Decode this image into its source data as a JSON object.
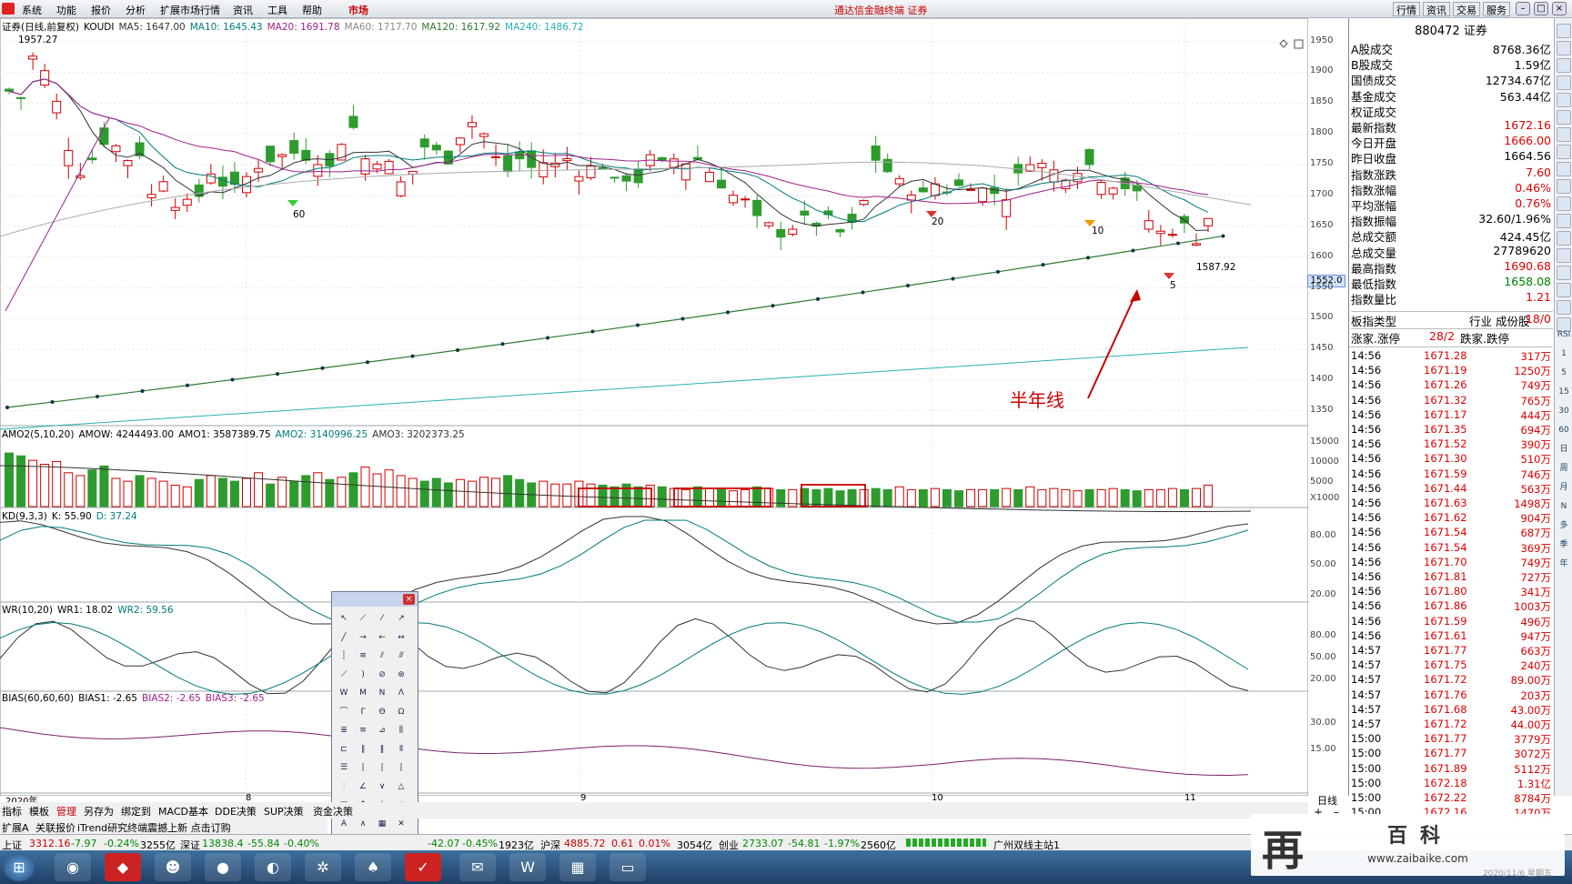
{
  "menubar": {
    "items": [
      "系统",
      "功能",
      "报价",
      "分析",
      "扩展市场行情",
      "资讯",
      "工具",
      "帮助"
    ],
    "market": "市场",
    "app_title": "通达信金融终端",
    "app_subtitle": "证券",
    "right_buttons": [
      "行情",
      "资讯",
      "交易",
      "服务"
    ]
  },
  "main_chart": {
    "header": {
      "name": "证券(日线,前复权)",
      "indicator": "KOUDI",
      "ma5": "MA5: 1647.00",
      "ma10": "MA10: 1645.43",
      "ma20": "MA20: 1691.78",
      "ma60": "MA60: 1717.70",
      "ma120": "MA120: 1617.92",
      "ma240": "MA240: 1486.72"
    },
    "y_ticks": [
      "1950",
      "1900",
      "1850",
      "1800",
      "1750",
      "1700",
      "1650",
      "1600",
      "1550",
      "1500",
      "1450",
      "1400",
      "1350"
    ],
    "price_box": "1552.0",
    "high_label": "1957.27",
    "low_label": "1587.92",
    "annotation": "半年线",
    "signal_labels": [
      "60",
      "20",
      "10",
      "5"
    ],
    "x_labels": [
      "2020年",
      "8",
      "9",
      "10",
      "11"
    ],
    "period": "日线"
  },
  "amo_panel": {
    "header": "AMO2(5,10,20)",
    "amow": "AMOW: 4244493.00",
    "amo1": "AMO1: 3587389.75",
    "amo2": "AMO2: 3140996.25",
    "amo3": "AMO3: 3202373.25",
    "y_ticks": [
      "15000",
      "10000",
      "5000",
      "X1000"
    ]
  },
  "kd_panel": {
    "header": "KD(9,3,3)",
    "k": "K: 55.90",
    "d": "D: 37.24",
    "y_ticks": [
      "80.00",
      "50.00",
      "20.00"
    ]
  },
  "wr_panel": {
    "header": "WR(10,20)",
    "wr1": "WR1: 18.02",
    "wr2": "WR2: 59.56",
    "y_ticks": [
      "80.00",
      "50.00",
      "20.00"
    ]
  },
  "bias_panel": {
    "header": "BIAS(60,60,60)",
    "bias1": "BIAS1: -2.65",
    "bias2": "BIAS2: -2.65",
    "bias3": "BIAS3: -2.65",
    "y_ticks": [
      "30.00",
      "15.00"
    ]
  },
  "right_panel": {
    "code": "880472",
    "name": "证券",
    "rows": [
      {
        "label": "A股成交",
        "value": "8768.36亿",
        "color": "blk"
      },
      {
        "label": "B股成交",
        "value": "1.59亿",
        "color": "blk"
      },
      {
        "label": "国债成交",
        "value": "12734.67亿",
        "color": "blk"
      },
      {
        "label": "基金成交",
        "value": "563.44亿",
        "color": "blk"
      },
      {
        "label": "权证成交",
        "value": "",
        "color": "blk"
      },
      {
        "label": "最新指数",
        "value": "1672.16",
        "color": "red"
      },
      {
        "label": "今日开盘",
        "value": "1666.00",
        "color": "red"
      },
      {
        "label": "昨日收盘",
        "value": "1664.56",
        "color": "blk"
      },
      {
        "label": "指数涨跌",
        "value": "7.60",
        "color": "red"
      },
      {
        "label": "指数涨幅",
        "value": "0.46%",
        "color": "red"
      },
      {
        "label": "平均涨幅",
        "value": "0.76%",
        "color": "red"
      },
      {
        "label": "指数振幅",
        "value": "32.60/1.96%",
        "color": "blk"
      },
      {
        "label": "总成交额",
        "value": "424.45亿",
        "color": "blk"
      },
      {
        "label": "总成交量",
        "value": "27789620",
        "color": "blk"
      },
      {
        "label": "最高指数",
        "value": "1690.68",
        "color": "red"
      },
      {
        "label": "最低指数",
        "value": "1658.08",
        "color": "grn"
      },
      {
        "label": "指数量比",
        "value": "1.21",
        "color": "red"
      }
    ],
    "sector_type_label": "板指类型",
    "sector_type_value": "行业 成份股",
    "sector_count": "18/0",
    "up_label": "涨家.涨停",
    "up_value": "28/2",
    "down_label": "跌家.跌停"
  },
  "trades": [
    {
      "t": "14:56",
      "p": "1671.28",
      "v": "317万"
    },
    {
      "t": "14:56",
      "p": "1671.19",
      "v": "1250万"
    },
    {
      "t": "14:56",
      "p": "1671.26",
      "v": "749万"
    },
    {
      "t": "14:56",
      "p": "1671.32",
      "v": "765万"
    },
    {
      "t": "14:56",
      "p": "1671.17",
      "v": "444万"
    },
    {
      "t": "14:56",
      "p": "1671.35",
      "v": "694万"
    },
    {
      "t": "14:56",
      "p": "1671.52",
      "v": "390万"
    },
    {
      "t": "14:56",
      "p": "1671.30",
      "v": "510万"
    },
    {
      "t": "14:56",
      "p": "1671.59",
      "v": "746万"
    },
    {
      "t": "14:56",
      "p": "1671.44",
      "v": "563万"
    },
    {
      "t": "14:56",
      "p": "1671.63",
      "v": "1498万"
    },
    {
      "t": "14:56",
      "p": "1671.62",
      "v": "904万"
    },
    {
      "t": "14:56",
      "p": "1671.54",
      "v": "687万"
    },
    {
      "t": "14:56",
      "p": "1671.54",
      "v": "369万"
    },
    {
      "t": "14:56",
      "p": "1671.70",
      "v": "749万"
    },
    {
      "t": "14:56",
      "p": "1671.81",
      "v": "727万"
    },
    {
      "t": "14:56",
      "p": "1671.80",
      "v": "341万"
    },
    {
      "t": "14:56",
      "p": "1671.86",
      "v": "1003万"
    },
    {
      "t": "14:56",
      "p": "1671.59",
      "v": "496万"
    },
    {
      "t": "14:56",
      "p": "1671.61",
      "v": "947万"
    },
    {
      "t": "14:57",
      "p": "1671.77",
      "v": "663万"
    },
    {
      "t": "14:57",
      "p": "1671.75",
      "v": "240万"
    },
    {
      "t": "14:57",
      "p": "1671.72",
      "v": "89.00万"
    },
    {
      "t": "14:57",
      "p": "1671.76",
      "v": "203万"
    },
    {
      "t": "14:57",
      "p": "1671.68",
      "v": "43.00万"
    },
    {
      "t": "14:57",
      "p": "1671.72",
      "v": "44.00万"
    },
    {
      "t": "15:00",
      "p": "1671.77",
      "v": "3779万"
    },
    {
      "t": "15:00",
      "p": "1671.77",
      "v": "3072万"
    },
    {
      "t": "15:00",
      "p": "1671.89",
      "v": "5112万"
    },
    {
      "t": "15:00",
      "p": "1672.18",
      "v": "1.31亿"
    },
    {
      "t": "15:00",
      "p": "1672.22",
      "v": "8784万"
    },
    {
      "t": "15:00",
      "p": "1672.16",
      "v": "1470万"
    }
  ],
  "right_toolbar": [
    "RSI",
    "1",
    "5",
    "15",
    "30",
    "60",
    "日",
    "周",
    "月",
    "N",
    "多",
    "季",
    "年"
  ],
  "tabs_row1": [
    "指标",
    "模板",
    "管理",
    "另存为",
    "绑定到",
    "MACD基本",
    "DDE决策",
    "SUP决策",
    "资金决策"
  ],
  "tabs_row2": [
    "扩展A",
    "关联报价",
    "iTrend研究终端震撼上新 点击订购"
  ],
  "statusbar": {
    "sh_label": "上证",
    "sh_val": "3312.16",
    "sh_chg": "-7.97",
    "sh_pct": "-0.24%",
    "sh_amt": "3255亿",
    "sz_label": "深证",
    "sz_val": "13838.4",
    "sz_chg": "-55.84",
    "sz_pct": "-0.40%",
    "mid_chg": "-42.07",
    "mid_pct": "-0.45%",
    "mid_amt": "1923亿",
    "hs_label": "沪深",
    "hs_val": "4885.72",
    "hs_chg": "0.61",
    "hs_pct": "0.01%",
    "hs_amt": "3054亿",
    "cy_label": "创业",
    "cy_val": "2733.07",
    "cy_chg": "-54.81",
    "cy_pct": "-1.97%",
    "cy_amt": "2560亿",
    "station": "广州双线主站1"
  },
  "watermark": {
    "brand_char": "再",
    "brand_text": "百科",
    "url": "www.zaibaike.com",
    "date": "2020/11/6 星期五"
  },
  "colors": {
    "up": "#d00000",
    "down": "#2e9b2e",
    "ma5": "#333333",
    "ma10": "#007a7a",
    "ma20": "#3355aa",
    "ma60": "#aaaaaa",
    "ma120": "#2f7a2f",
    "ma240": "#28b0b0"
  }
}
